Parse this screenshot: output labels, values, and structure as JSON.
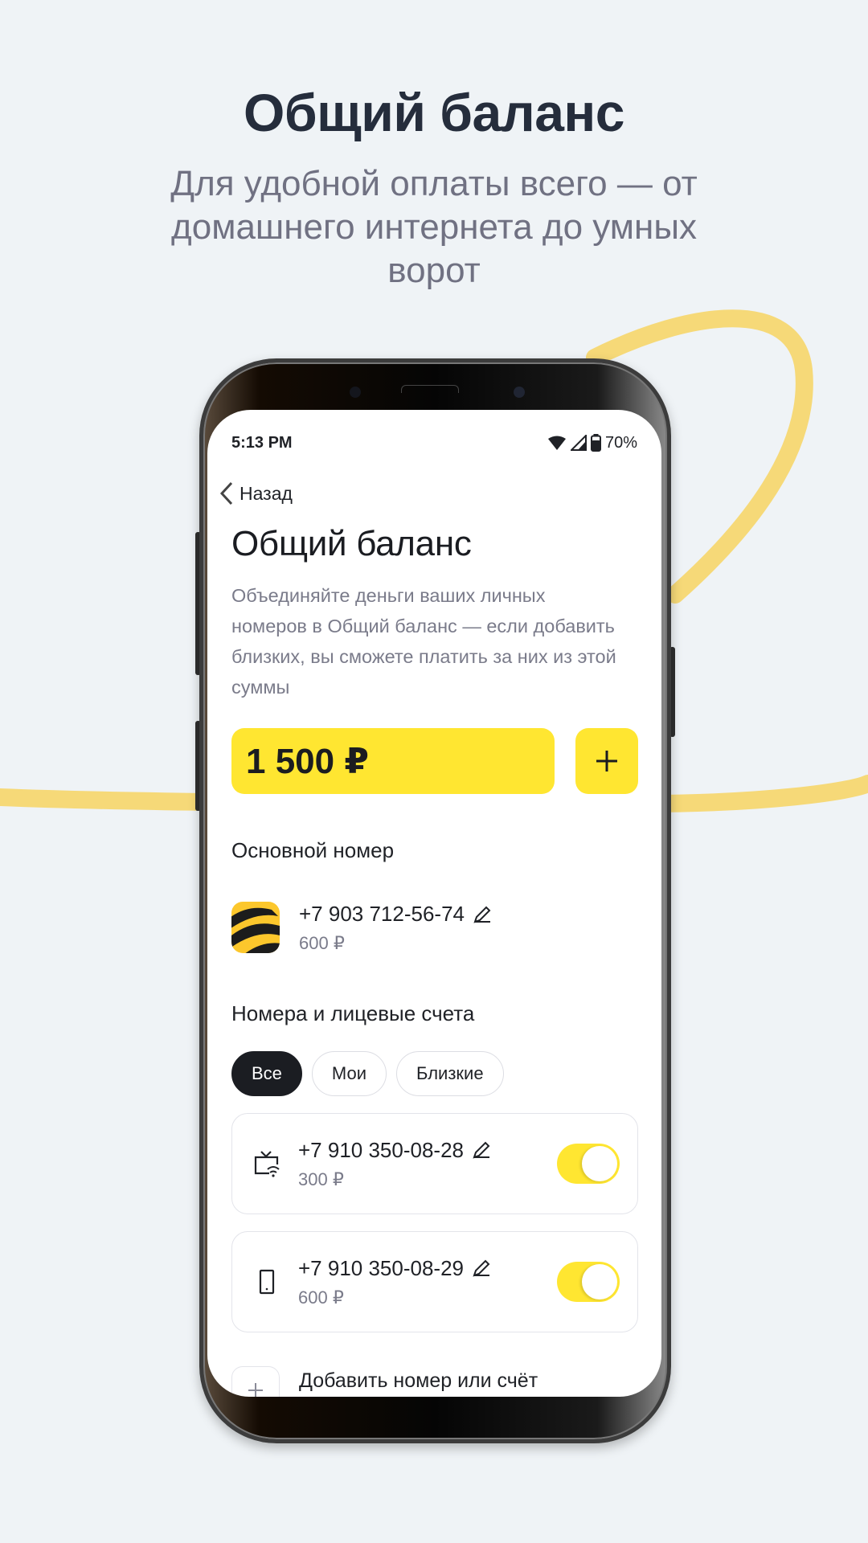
{
  "promo": {
    "title": "Общий баланс",
    "subtitle": "Для удобной оплаты всего — от домашнего интернета до умных ворот"
  },
  "colors": {
    "accent": "#ffe631",
    "ring": "#f6d978",
    "dark": "#1b1d22",
    "muted": "#7a7b8a"
  },
  "status_bar": {
    "time": "5:13 PM",
    "battery": "70%",
    "icons": [
      "wifi-icon",
      "signal-icon",
      "battery-icon"
    ]
  },
  "screen": {
    "back_label": "Назад",
    "title": "Общий баланс",
    "description": "Объединяйте деньги ваших личных номеров в Общий баланс — если добавить близких, вы сможете платить за них из этой суммы",
    "balance": "1 500 ₽",
    "add_button_icon": "plus-icon",
    "main_section_title": "Основной номер",
    "main_number": {
      "phone": "+7 903 712-56-74",
      "amount": "600 ₽",
      "icon": "beeline-logo-icon"
    },
    "accounts_section_title": "Номера и лицевые счета",
    "filters": [
      {
        "label": "Все",
        "active": true
      },
      {
        "label": "Мои",
        "active": false
      },
      {
        "label": "Близкие",
        "active": false
      }
    ],
    "accounts": [
      {
        "phone": "+7 910 350-08-28",
        "amount": "300 ₽",
        "icon": "tv-wifi-icon",
        "enabled": true
      },
      {
        "phone": "+7 910 350-08-29",
        "amount": "600 ₽",
        "icon": "smartphone-icon",
        "enabled": true
      }
    ],
    "add_account_label": "Добавить номер или счёт"
  }
}
